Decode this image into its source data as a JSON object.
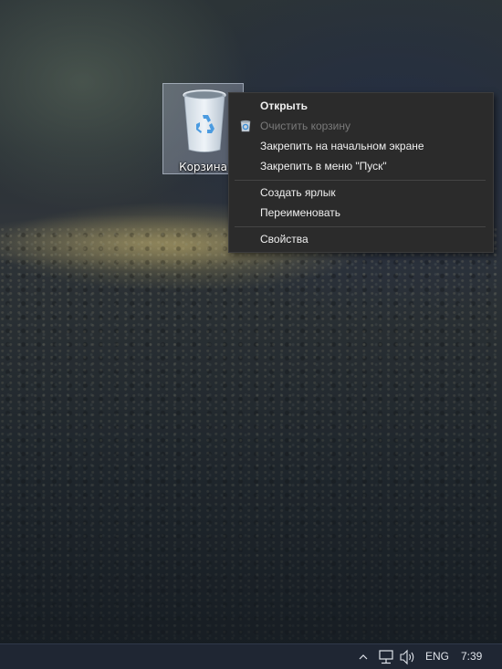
{
  "desktop": {
    "recycle_bin": {
      "label": "Корзина",
      "icon": "recycle-bin-icon"
    }
  },
  "context_menu": {
    "items": [
      {
        "label": "Открыть",
        "bold": true,
        "enabled": true
      },
      {
        "label": "Очистить корзину",
        "bold": false,
        "enabled": false,
        "icon": "recycle-bin-small-icon"
      },
      {
        "label": "Закрепить на начальном экране",
        "bold": false,
        "enabled": true
      },
      {
        "label": "Закрепить в меню \"Пуск\"",
        "bold": false,
        "enabled": true
      },
      {
        "label": "Создать ярлык",
        "bold": false,
        "enabled": true
      },
      {
        "label": "Переименовать",
        "bold": false,
        "enabled": true
      },
      {
        "label": "Свойства",
        "bold": false,
        "enabled": true
      }
    ]
  },
  "taskbar": {
    "tray": {
      "chevron_icon": "chevron-up-icon",
      "network_icon": "network-icon",
      "volume_icon": "volume-icon",
      "language": "ENG",
      "time": "7:39"
    }
  },
  "colors": {
    "menu_background": "#2b2b2b",
    "menu_text": "#f0f0f0",
    "menu_disabled_text": "#7a7a7a",
    "taskbar_background": "#202634"
  }
}
